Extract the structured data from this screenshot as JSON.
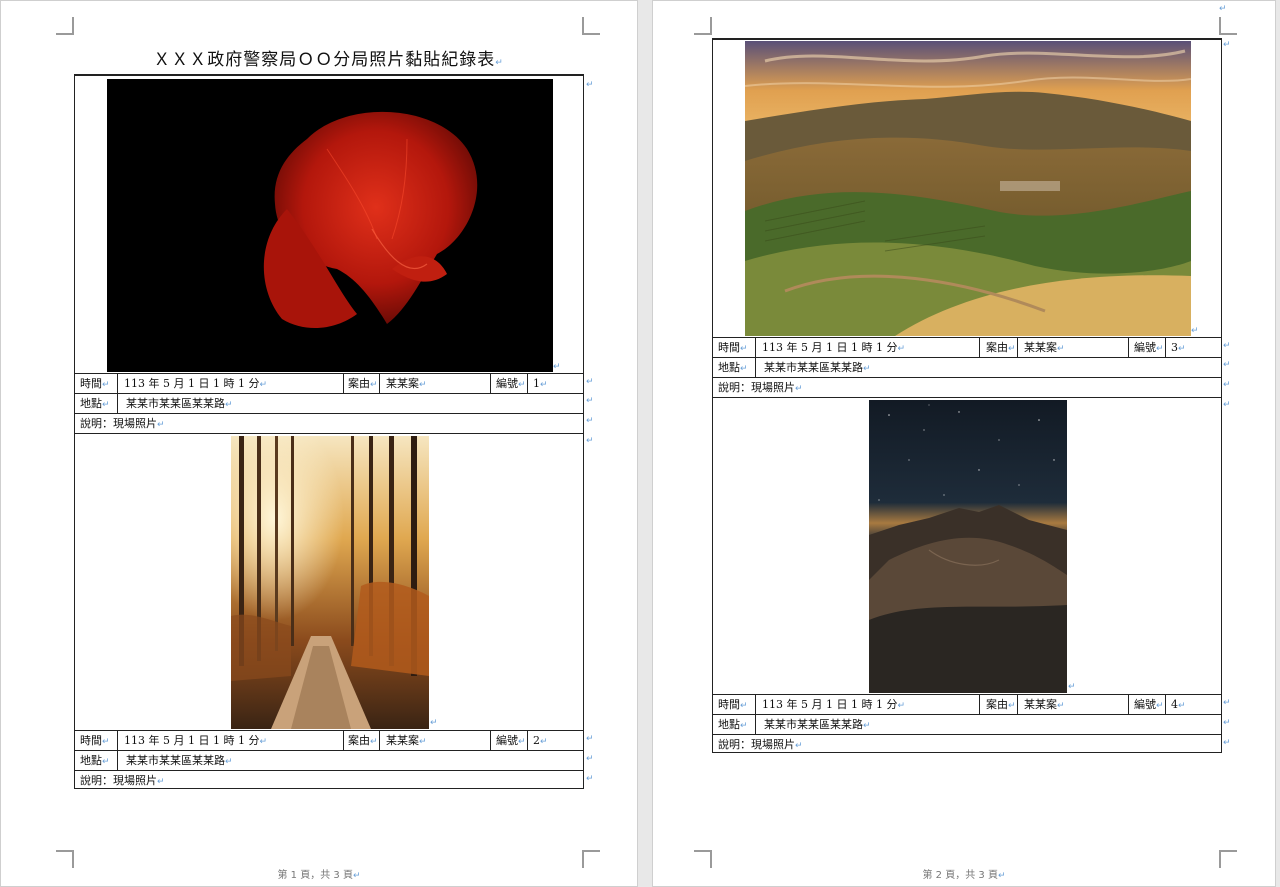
{
  "document": {
    "title": "ＸＸＸ政府警察局ＯＯ分局照片黏貼紀錄表"
  },
  "labels": {
    "time": "時間",
    "case": "案由",
    "number": "編號",
    "location": "地點",
    "description_prefix": "說明："
  },
  "records": [
    {
      "time": "113 年 5 月 1 日 1 時 1 分",
      "case": "某某案",
      "number": "1",
      "location": "某某市某某區某某路",
      "description": "現場照片"
    },
    {
      "time": "113 年 5 月 1 日 1 時 1 分",
      "case": "某某案",
      "number": "2",
      "location": "某某市某某區某某路",
      "description": "現場照片"
    },
    {
      "time": "113 年 5 月 1 日 1 時 1 分",
      "case": "某某案",
      "number": "3",
      "location": "某某市某某區某某路",
      "description": "現場照片"
    },
    {
      "time": "113 年 5 月 1 日 1 時 1 分",
      "case": "某某案",
      "number": "4",
      "location": "某某市某某區某某路",
      "description": "現場照片"
    }
  ],
  "photo_icons": [
    "red-betta-fish-photo",
    "sunlit-forest-path-photo",
    "hillside-vineyard-sunset-photo",
    "mountain-night-sky-photo"
  ],
  "footers": {
    "page1": "第 1 頁，共 3 頁",
    "page2": "第 2 頁，共 3 頁"
  },
  "colors": {
    "paragraph_mark": "#6aa0d8",
    "table_border": "#222222"
  }
}
